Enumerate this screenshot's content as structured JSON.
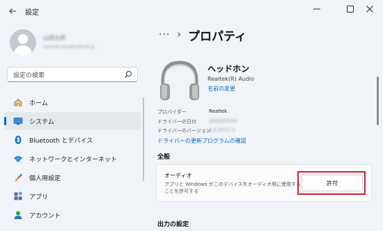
{
  "window": {
    "title": "設定",
    "back_icon": "arrow-left-icon",
    "controls": [
      "minimize-icon",
      "maximize-icon",
      "close-icon"
    ]
  },
  "sidebar": {
    "user_name": "山田太郎",
    "user_email": "yamada.taro@outlook.jp",
    "search_placeholder": "設定の検索",
    "items": [
      {
        "label": "ホーム",
        "icon": "home-icon",
        "selected": false
      },
      {
        "label": "システム",
        "icon": "monitor-icon",
        "selected": true
      },
      {
        "label": "Bluetooth とデバイス",
        "icon": "bluetooth-icon",
        "selected": false
      },
      {
        "label": "ネットワークとインターネット",
        "icon": "wifi-icon",
        "selected": false
      },
      {
        "label": "個人用設定",
        "icon": "brush-icon",
        "selected": false
      },
      {
        "label": "アプリ",
        "icon": "apps-icon",
        "selected": false
      },
      {
        "label": "アカウント",
        "icon": "account-icon",
        "selected": false
      }
    ]
  },
  "main": {
    "breadcrumb_more": "···",
    "breadcrumb_sep": "›",
    "page_title": "プロパティ",
    "device": {
      "name": "ヘッドホン",
      "vendor": "Realtek(R) Audio",
      "rename_link": "名前の変更"
    },
    "properties": [
      {
        "label": "プロバイダー",
        "value": "Realtek",
        "blurred": false
      },
      {
        "label": "ドライバーの日付",
        "value": "2024/07/10",
        "blurred": true
      },
      {
        "label": "ドライバーのバージョン",
        "value": "6.0.9717.1",
        "blurred": true
      }
    ],
    "update_link": "ドライバーの更新プログラムの確認",
    "section_general": "全般",
    "audio_card": {
      "title": "オーディオ",
      "description": "アプリと Windows がこのデバイスをオーディオ用に使用することを許可する",
      "button": "許可"
    },
    "section_output": "出力の設定"
  },
  "colors": {
    "accent": "#0067c0",
    "highlight": "#d41f2a"
  }
}
